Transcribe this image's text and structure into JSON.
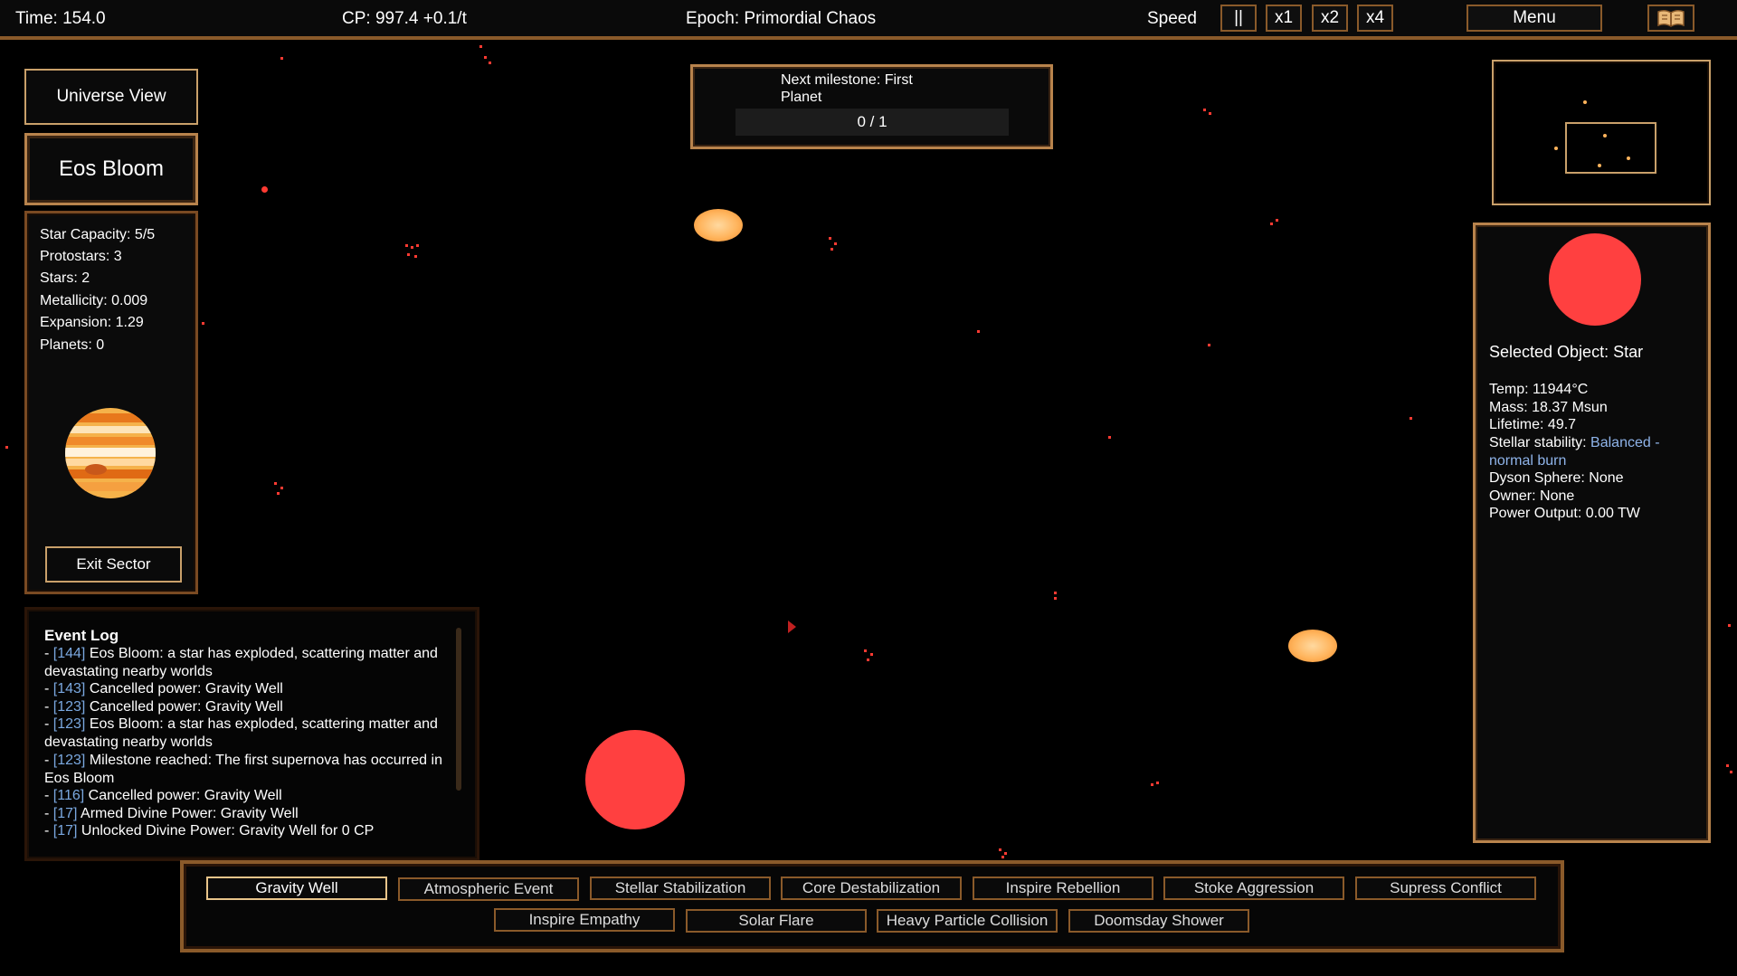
{
  "topbar": {
    "time": "Time: 154.0",
    "cp": "CP: 997.4 +0.1/t",
    "epoch": "Epoch: Primordial Chaos",
    "speed_label": "Speed",
    "speed_buttons": [
      "||",
      "x1",
      "x2",
      "x4"
    ],
    "menu_label": "Menu"
  },
  "left": {
    "universe_view_label": "Universe View",
    "sector_name": "Eos Bloom",
    "stats": [
      "Star Capacity: 5/5",
      "Protostars: 3",
      "Stars: 2",
      "Metallicity: 0.009",
      "Expansion: 1.29",
      "Planets: 0"
    ],
    "exit_label": "Exit Sector"
  },
  "milestone": {
    "text": "Next milestone: First Planet",
    "progress_text": "0 / 1",
    "progress": 0
  },
  "event_log": {
    "title": "Event Log",
    "entries": [
      {
        "num": "[144]",
        "text": "Eos Bloom: a star has exploded, scattering matter and devastating nearby worlds"
      },
      {
        "num": "[143]",
        "text": "Cancelled power: Gravity Well"
      },
      {
        "num": "[123]",
        "text": "Cancelled power: Gravity Well"
      },
      {
        "num": "[123]",
        "text": "Eos Bloom: a star has exploded, scattering matter and devastating nearby worlds"
      },
      {
        "num": "[123]",
        "text": "Milestone reached: The first supernova has occurred in Eos Bloom"
      },
      {
        "num": "[116]",
        "text": "Cancelled power: Gravity Well"
      },
      {
        "num": "[17]",
        "text": "Armed Divine Power: Gravity Well"
      },
      {
        "num": "[17]",
        "text": "Unlocked Divine Power: Gravity Well for 0 CP"
      }
    ]
  },
  "selected": {
    "title": "Selected Object: Star",
    "temp": "Temp: 11944°C",
    "mass": "Mass: 18.37 Msun",
    "lifetime": "Lifetime: 49.7",
    "stability_label": "Stellar stability: ",
    "stability_value": "Balanced - normal burn",
    "dyson": "Dyson Sphere: None",
    "owner": "Owner: None",
    "power": "Power Output: 0.00 TW"
  },
  "powers": {
    "row1": [
      "Gravity Well",
      "Atmospheric Event",
      "Stellar Stabilization",
      "Core Destabilization",
      "Inspire Rebellion",
      "Stoke Aggression",
      "Supress Conflict"
    ],
    "row2": [
      "Inspire Empathy",
      "Solar Flare",
      "Heavy Particle Collision",
      "Doomsday Shower"
    ],
    "active": "Gravity Well"
  },
  "colors": {
    "accent": "#8a5a2a",
    "star": "#ff4040",
    "protostar": "#ffb86a",
    "log_number": "#7aa8e0"
  },
  "icons": {
    "book": "book-icon",
    "planet": "gas-giant-icon"
  }
}
